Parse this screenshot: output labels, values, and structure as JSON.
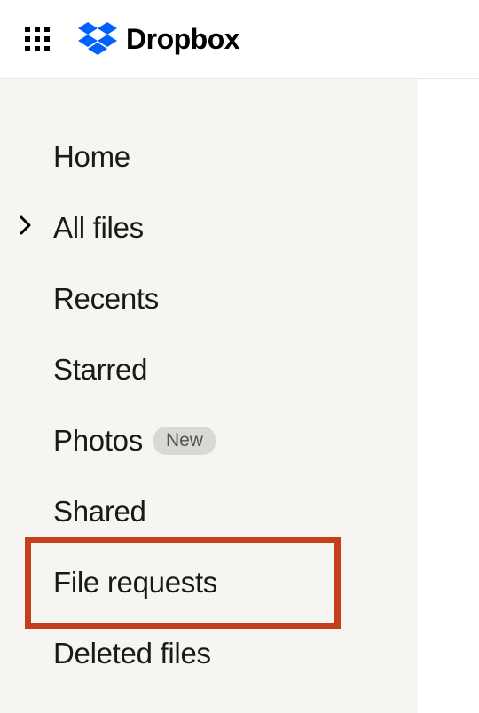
{
  "brand": {
    "name": "Dropbox",
    "logo_color": "#0061fe"
  },
  "sidebar": {
    "items": [
      {
        "label": "Home",
        "expandable": false,
        "badge": null
      },
      {
        "label": "All files",
        "expandable": true,
        "badge": null
      },
      {
        "label": "Recents",
        "expandable": false,
        "badge": null
      },
      {
        "label": "Starred",
        "expandable": false,
        "badge": null
      },
      {
        "label": "Photos",
        "expandable": false,
        "badge": "New"
      },
      {
        "label": "Shared",
        "expandable": false,
        "badge": null
      },
      {
        "label": "File requests",
        "expandable": false,
        "badge": null
      },
      {
        "label": "Deleted files",
        "expandable": false,
        "badge": null
      }
    ]
  }
}
